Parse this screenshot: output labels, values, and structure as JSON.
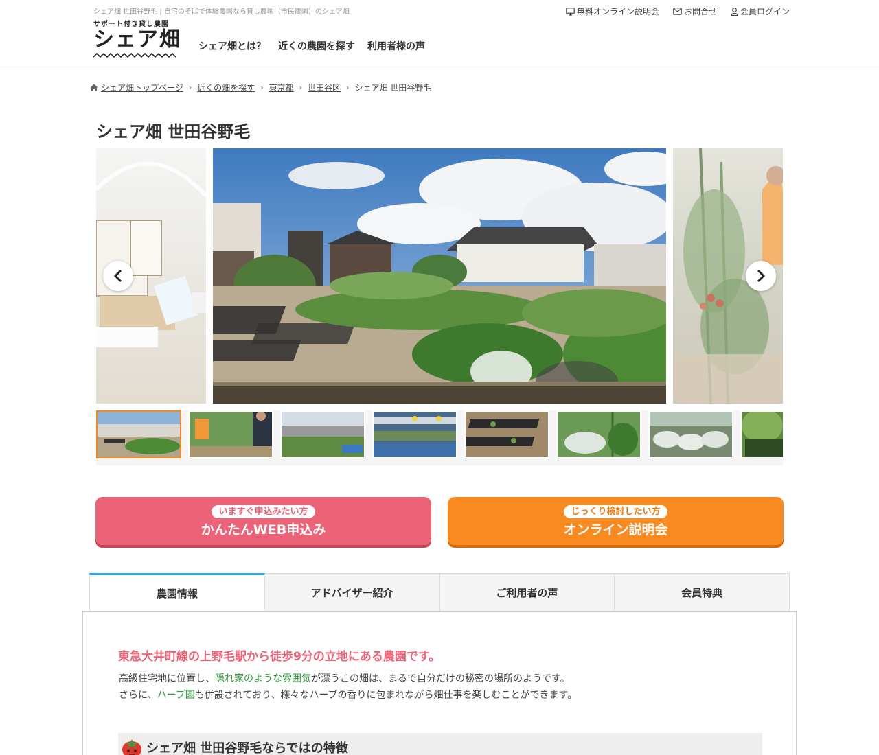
{
  "header": {
    "tagline": "シェア畑 世田谷野毛 | 自宅のそばで体験農園なら貸し農園（市民農園）のシェア畑",
    "logo_sub": "サポート付き貸し農園",
    "logo_main": "シェア畑",
    "nav": [
      "シェア畑とは？",
      "近くの農園を探す",
      "利用者様の声"
    ],
    "util_nav": [
      {
        "label": "無料オンライン説明会",
        "icon": "monitor-icon"
      },
      {
        "label": "お問合せ",
        "icon": "mail-icon"
      },
      {
        "label": "会員ログイン",
        "icon": "user-icon"
      }
    ]
  },
  "breadcrumb": [
    "シェア畑トップページ",
    "近くの畑を探す",
    "東京都",
    "世田谷区",
    "シェア畑 世田谷野毛"
  ],
  "page_title": "シェア畑 世田谷野毛",
  "gallery": {
    "thumb_count": 8,
    "active_thumb": 1
  },
  "cta": {
    "apply_pill": "いますぐ申込みたい方",
    "apply_label": "かんたんWEB申込み",
    "online_pill": "じっくり検討したい方",
    "online_label": "オンライン説明会"
  },
  "tabs": [
    "農園情報",
    "アドバイザー紹介",
    "ご利用者の声",
    "会員特典"
  ],
  "farm_info": {
    "lead": "東急大井町線の上野毛駅から徒歩9分の立地にある農園です。",
    "line1_a": "高級住宅地に位置し、",
    "line1_green": "隠れ家のような雰囲気",
    "line1_b": "が漂うこの畑は、まるで自分だけの秘密の場所のようです。",
    "line2_a": "さらに、",
    "line2_green": "ハーブ園",
    "line2_b": "も併設されており、様々なハーブの香りに包まれながら畑仕事を楽しむことができます。",
    "feature_heading": "シェア畑 世田谷野毛ならではの特徴"
  },
  "colors": {
    "pink": "#ec6377",
    "orange": "#f98a20",
    "tab_accent": "#29a9e0",
    "green_text": "#2e9a3a"
  }
}
